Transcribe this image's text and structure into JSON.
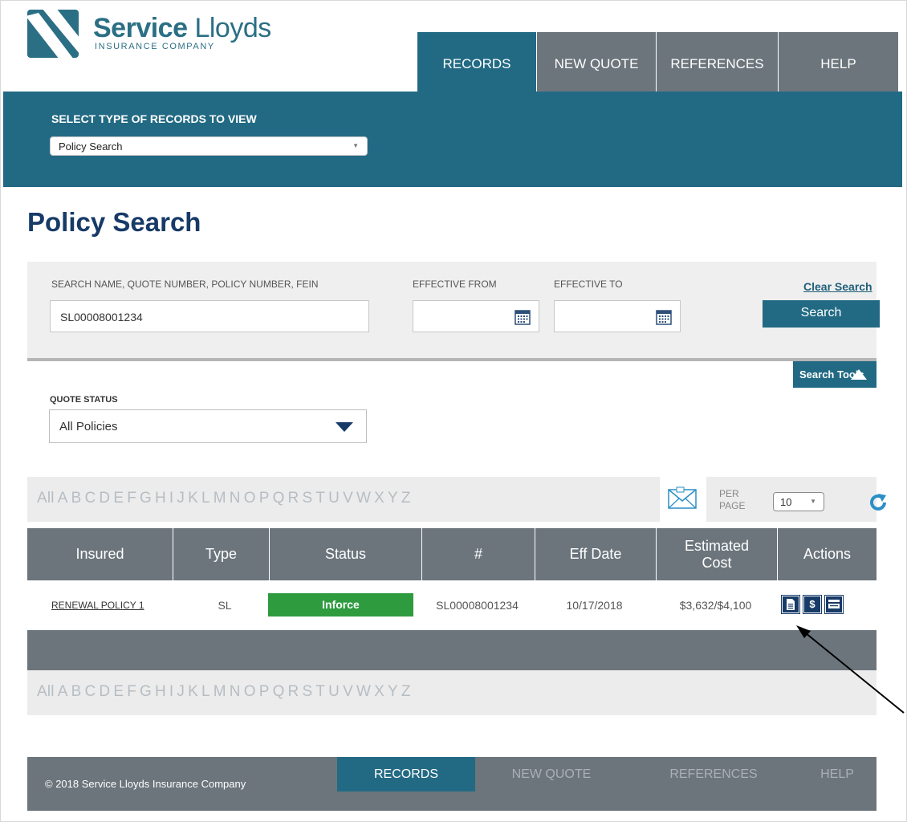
{
  "header": {
    "brand_bold": "Service",
    "brand_light": "Lloyds",
    "brand_sub": "INSURANCE COMPANY",
    "nav": [
      {
        "label": "RECORDS"
      },
      {
        "label": "NEW QUOTE"
      },
      {
        "label": "REFERENCES"
      },
      {
        "label": "HELP"
      }
    ]
  },
  "records_select": {
    "label": "SELECT TYPE OF RECORDS TO VIEW",
    "value": "Policy Search"
  },
  "page_title": "Policy Search",
  "search": {
    "query_label": "SEARCH NAME, QUOTE NUMBER, POLICY NUMBER, FEIN",
    "query_value": "SL00008001234",
    "from_label": "EFFECTIVE FROM",
    "to_label": "EFFECTIVE TO",
    "clear_label": "Clear Search",
    "search_label": "Search",
    "tools_label": "Search Tools"
  },
  "quote_status": {
    "label": "QUOTE STATUS",
    "value": "All Policies"
  },
  "alphabet": [
    "All",
    "A",
    "B",
    "C",
    "D",
    "E",
    "F",
    "G",
    "H",
    "I",
    "J",
    "K",
    "L",
    "M",
    "N",
    "O",
    "P",
    "Q",
    "R",
    "S",
    "T",
    "U",
    "V",
    "W",
    "X",
    "Y",
    "Z"
  ],
  "per_page": {
    "label_1": "PER",
    "label_2": "PAGE",
    "value": "10"
  },
  "table": {
    "headers": [
      "Insured",
      "Type",
      "Status",
      "#",
      "Eff Date",
      "Estimated Cost",
      "Actions"
    ],
    "rows": [
      {
        "insured": "RENEWAL POLICY 1",
        "type": "SL",
        "status": "Inforce",
        "number": "SL00008001234",
        "eff_date": "10/17/2018",
        "estimated_cost": "$3,632/$4,100",
        "action_dollar": "$"
      }
    ]
  },
  "colors": {
    "brand_teal": "#226a84",
    "navy": "#173a67",
    "gray": "#6c757c",
    "status_green": "#2e9b3f"
  },
  "footer": {
    "copyright": "© 2018 Service Lloyds Insurance Company",
    "nav": [
      {
        "label": "RECORDS"
      },
      {
        "label": "NEW QUOTE"
      },
      {
        "label": "REFERENCES"
      },
      {
        "label": "HELP"
      }
    ]
  }
}
